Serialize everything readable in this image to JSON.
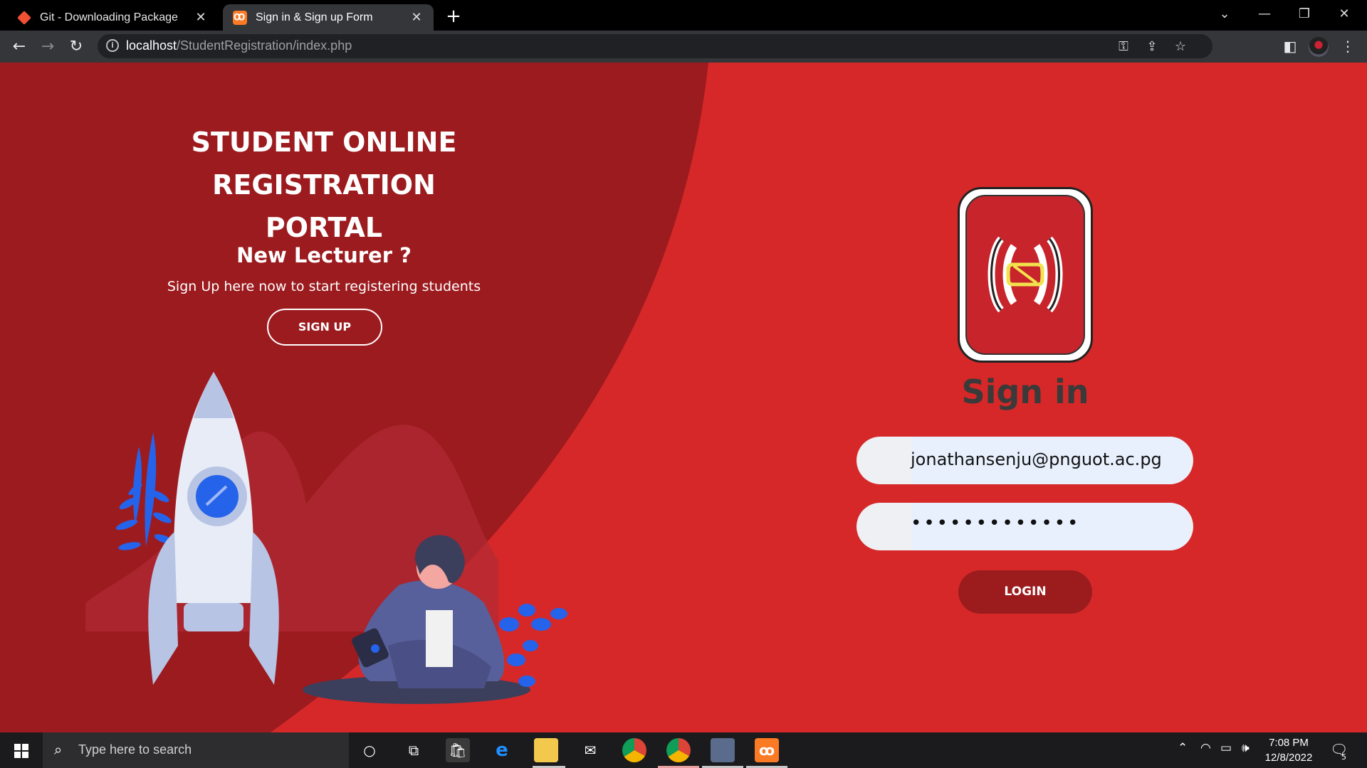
{
  "browser": {
    "tabs": [
      {
        "title": "Git - Downloading Package",
        "icon": "git-icon",
        "active": false
      },
      {
        "title": "Sign in & Sign up Form",
        "icon": "xampp-icon",
        "active": true
      }
    ],
    "url_host": "localhost",
    "url_path": "/StudentRegistration/index.php"
  },
  "left_panel": {
    "heading_line1": "STUDENT ONLINE REGISTRATION",
    "heading_line2": "PORTAL",
    "subtitle": "New Lecturer ?",
    "text": "Sign Up here now to start registering students",
    "signup_label": "SIGN UP"
  },
  "signin": {
    "title": "Sign in",
    "email_value": "jonathansenju@pnguot.ac.pg",
    "password_value": "•••••••••••••",
    "login_label": "LOGIN"
  },
  "taskbar": {
    "search_placeholder": "Type here to search",
    "time": "7:08 PM",
    "date": "12/8/2022",
    "notification_count": "5"
  },
  "colors": {
    "page_red": "#d62828",
    "dark_red": "#9c1c1e",
    "tab_active": "#35363a"
  }
}
